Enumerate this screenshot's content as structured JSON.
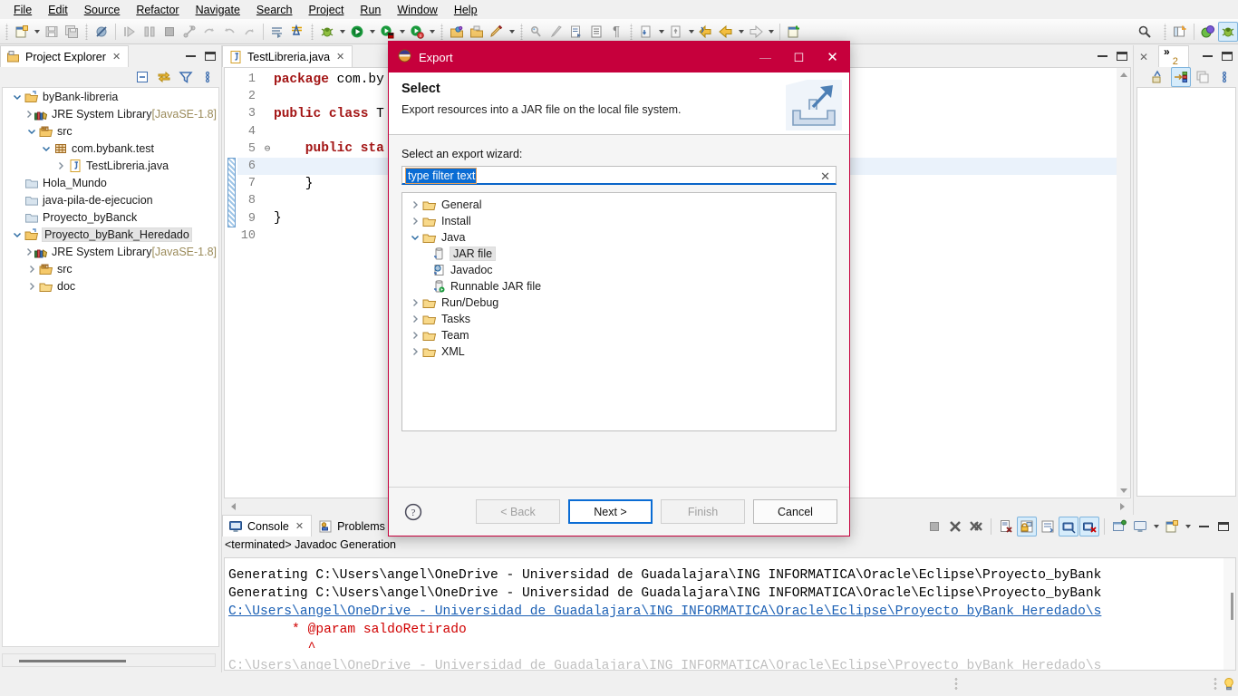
{
  "menu": {
    "items": [
      "File",
      "Edit",
      "Source",
      "Refactor",
      "Navigate",
      "Search",
      "Project",
      "Run",
      "Window",
      "Help"
    ]
  },
  "toolbar": {
    "icons": [
      "new-wizard-icon",
      "save-icon",
      "save-all-icon",
      "skip-all-breakpoints-icon",
      "step-into-icon",
      "step-over-icon",
      "terminate-icon",
      "build-icon",
      "undo-step-icon",
      "redo-step-icon",
      "step-return-icon",
      "open-type-icon",
      "open-task-icon",
      "debug-icon",
      "run-icon",
      "run-last-tool-icon",
      "external-tools-icon",
      "open-perspective-icon",
      "open-folder-icon",
      "search-icon",
      "annotate-icon",
      "next-annotation-icon",
      "previous-annotation-icon",
      "show-whitespace-icon",
      "toggle-mark-occurrences-icon",
      "back-icon",
      "forward-icon",
      "new-java-project-icon"
    ]
  },
  "projectExplorer": {
    "title": "Project Explorer",
    "toolbar": [
      "collapse-all-icon",
      "link-with-editor-icon",
      "view-menu-filter-icon",
      "view-menu-icon"
    ],
    "tree": [
      {
        "label": "byBank-libreria",
        "suffix": "",
        "icon": "java-project-icon",
        "indent": 0,
        "twisty": "expanded",
        "selected": false
      },
      {
        "label": "JRE System Library ",
        "suffix": "[JavaSE-1.8]",
        "icon": "library-icon",
        "indent": 1,
        "twisty": "collapsed",
        "selected": false
      },
      {
        "label": "src",
        "suffix": "",
        "icon": "source-folder-icon",
        "indent": 1,
        "twisty": "expanded",
        "selected": false
      },
      {
        "label": "com.bybank.test",
        "suffix": "",
        "icon": "package-icon",
        "indent": 2,
        "twisty": "expanded",
        "selected": false
      },
      {
        "label": "TestLibreria.java",
        "suffix": "",
        "icon": "java-file-icon",
        "indent": 3,
        "twisty": "collapsed",
        "selected": false
      },
      {
        "label": "Hola_Mundo",
        "suffix": "",
        "icon": "closed-project-icon",
        "indent": 0,
        "twisty": "none",
        "selected": false
      },
      {
        "label": "java-pila-de-ejecucion",
        "suffix": "",
        "icon": "closed-project-icon",
        "indent": 0,
        "twisty": "none",
        "selected": false
      },
      {
        "label": "Proyecto_byBanck",
        "suffix": "",
        "icon": "closed-project-icon",
        "indent": 0,
        "twisty": "none",
        "selected": false
      },
      {
        "label": "Proyecto_byBank_Heredado",
        "suffix": "",
        "icon": "java-project-icon",
        "indent": 0,
        "twisty": "expanded",
        "selected": true
      },
      {
        "label": "JRE System Library ",
        "suffix": "[JavaSE-1.8]",
        "icon": "library-icon",
        "indent": 1,
        "twisty": "collapsed",
        "selected": false
      },
      {
        "label": "src",
        "suffix": "",
        "icon": "source-folder-icon",
        "indent": 1,
        "twisty": "collapsed",
        "selected": false
      },
      {
        "label": "doc",
        "suffix": "",
        "icon": "folder-icon",
        "indent": 1,
        "twisty": "collapsed",
        "selected": false
      }
    ]
  },
  "editor": {
    "tab": {
      "label": "TestLibreria.java",
      "close": "✕"
    },
    "lines": [
      {
        "no": "1",
        "fold": "",
        "segments": [
          {
            "t": "package",
            "c": "kw"
          },
          {
            "t": " com.by",
            "c": "plain"
          }
        ],
        "current": false
      },
      {
        "no": "2",
        "fold": "",
        "segments": [],
        "current": false
      },
      {
        "no": "3",
        "fold": "",
        "segments": [
          {
            "t": "public class ",
            "c": "kw"
          },
          {
            "t": "T",
            "c": "plain"
          }
        ],
        "current": false
      },
      {
        "no": "4",
        "fold": "",
        "segments": [],
        "current": false
      },
      {
        "no": "5",
        "fold": "⊖",
        "segments": [
          {
            "t": "    public sta",
            "c": "kw"
          }
        ],
        "current": false
      },
      {
        "no": "6",
        "fold": "",
        "segments": [],
        "current": true
      },
      {
        "no": "7",
        "fold": "",
        "segments": [
          {
            "t": "    }",
            "c": "plain"
          }
        ],
        "current": false
      },
      {
        "no": "8",
        "fold": "",
        "segments": [],
        "current": false
      },
      {
        "no": "9",
        "fold": "",
        "segments": [
          {
            "t": "}",
            "c": "plain"
          }
        ],
        "current": false
      },
      {
        "no": "10",
        "fold": "",
        "segments": [],
        "current": false
      }
    ]
  },
  "outline": {
    "tab_badge": "2",
    "toolbar": [
      "sort-icon",
      "hide-fields-icon",
      "hide-static-icon",
      "view-menu-icon"
    ]
  },
  "console": {
    "tabs": [
      {
        "label": "Console",
        "icon": "console-icon",
        "active": true,
        "close": "✕"
      },
      {
        "label": "Problems",
        "icon": "problems-icon",
        "active": false,
        "close": ""
      }
    ],
    "status": "<terminated> Javadoc Generation",
    "lines": [
      {
        "text": "Generating C:\\Users\\angel\\OneDrive - Universidad de Guadalajara\\ING INFORMATICA\\Oracle\\Eclipse\\Proyecto_byBank",
        "style": "normal"
      },
      {
        "text": "Generating C:\\Users\\angel\\OneDrive - Universidad de Guadalajara\\ING INFORMATICA\\Oracle\\Eclipse\\Proyecto_byBank",
        "style": "normal"
      },
      {
        "text": "C:\\Users\\angel\\OneDrive - Universidad de Guadalajara\\ING INFORMATICA\\Oracle\\Eclipse\\Proyecto_byBank_Heredado\\s",
        "style": "link"
      },
      {
        "text": "        * @param saldoRetirado",
        "style": "err"
      },
      {
        "text": "          ^",
        "style": "err"
      }
    ],
    "toolbar": [
      "terminate-icon",
      "remove-launch-icon",
      "remove-all-terminated-icon",
      "clear-console-icon",
      "scroll-lock-icon",
      "word-wrap-icon",
      "show-console-on-output-icon",
      "pin-console-icon",
      "display-selected-console-icon",
      "open-console-icon",
      "minimize-icon",
      "maximize-icon"
    ]
  },
  "dialog": {
    "title": "Export",
    "title_icon": "export-wizard-icon",
    "window_controls": {
      "minimize": "—",
      "maximize": "☐",
      "close": "✕"
    },
    "heading": "Select",
    "description": "Export resources into a JAR file on the local file system.",
    "banner_icon": "export-banner-icon",
    "label": "Select an export wizard:",
    "filter": {
      "value": "type filter text",
      "clear_icon": "clear-icon"
    },
    "wizards": [
      {
        "label": "General",
        "icon": "folder-icon",
        "twisty": "collapsed",
        "child": false,
        "selected": false
      },
      {
        "label": "Install",
        "icon": "folder-icon",
        "twisty": "collapsed",
        "child": false,
        "selected": false
      },
      {
        "label": "Java",
        "icon": "folder-icon",
        "twisty": "expanded",
        "child": false,
        "selected": false
      },
      {
        "label": "JAR file",
        "icon": "jar-icon",
        "twisty": "none",
        "child": true,
        "selected": true
      },
      {
        "label": "Javadoc",
        "icon": "javadoc-icon",
        "twisty": "none",
        "child": true,
        "selected": false
      },
      {
        "label": "Runnable JAR file",
        "icon": "runnable-jar-icon",
        "twisty": "none",
        "child": true,
        "selected": false
      },
      {
        "label": "Run/Debug",
        "icon": "folder-icon",
        "twisty": "collapsed",
        "child": false,
        "selected": false
      },
      {
        "label": "Tasks",
        "icon": "folder-icon",
        "twisty": "collapsed",
        "child": false,
        "selected": false
      },
      {
        "label": "Team",
        "icon": "folder-icon",
        "twisty": "collapsed",
        "child": false,
        "selected": false
      },
      {
        "label": "XML",
        "icon": "folder-icon",
        "twisty": "collapsed",
        "child": false,
        "selected": false
      }
    ],
    "help_icon": "help-icon",
    "buttons": {
      "back": "< Back",
      "next": "Next >",
      "finish": "Finish",
      "cancel": "Cancel"
    }
  },
  "statusbar": {
    "tip_icon": "tip-of-the-day-icon"
  },
  "colors": {
    "dialog_accent": "#c6003c",
    "selection_blue": "#0a6cd4",
    "link_blue": "#1a5fb4",
    "error_red": "#d00000",
    "keyword_red": "#a31515"
  }
}
